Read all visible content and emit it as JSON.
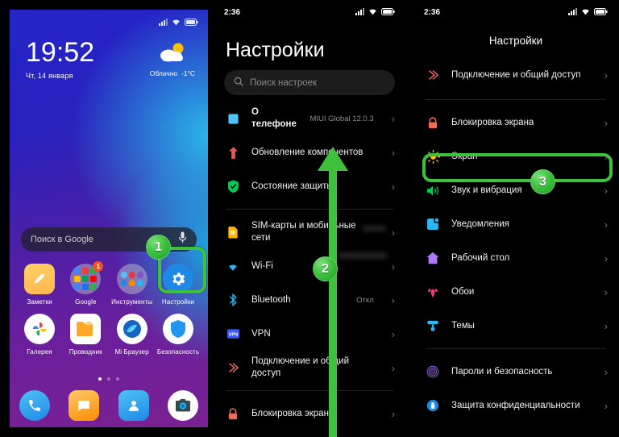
{
  "home": {
    "status_bar": {
      "icons": [
        "signal-icon",
        "wifi-icon",
        "battery-icon"
      ]
    },
    "clock": {
      "time": "19:52",
      "date": "Чт, 14 января"
    },
    "weather": {
      "condition": "Облачно",
      "temperature": "-1°C",
      "icon": "partly-cloudy-icon"
    },
    "search": {
      "placeholder": "Поиск в Google",
      "mic_icon": "microphone-icon",
      "search_icon": "google-search-icon"
    },
    "apps_row1": [
      {
        "label": "Заметки",
        "icon": "notes-icon",
        "badge": ""
      },
      {
        "label": "Google",
        "icon": "google-folder-icon",
        "badge": "1"
      },
      {
        "label": "Инструменты",
        "icon": "tools-folder-icon",
        "badge": ""
      },
      {
        "label": "Настройки",
        "icon": "settings-gear-icon",
        "badge": ""
      }
    ],
    "apps_row2": [
      {
        "label": "Галерея",
        "icon": "gallery-icon",
        "badge": ""
      },
      {
        "label": "Проводник",
        "icon": "file-manager-icon",
        "badge": ""
      },
      {
        "label": "Mi Браузер",
        "icon": "mi-browser-icon",
        "badge": ""
      },
      {
        "label": "Безопасность",
        "icon": "security-shield-icon",
        "badge": ""
      }
    ],
    "page_dots": {
      "count": 3,
      "active": 0
    },
    "dock": [
      {
        "label": "",
        "icon": "phone-icon"
      },
      {
        "label": "",
        "icon": "messages-icon"
      },
      {
        "label": "",
        "icon": "contacts-icon"
      },
      {
        "label": "",
        "icon": "camera-icon"
      }
    ]
  },
  "settings_main": {
    "status_bar": {
      "time": "2:36",
      "icons": [
        "signal-icon",
        "wifi-icon",
        "battery-icon"
      ]
    },
    "title": "Настройки",
    "search": {
      "placeholder": "Поиск настроек",
      "icon": "search-icon"
    },
    "rows": [
      {
        "label": "О телефоне",
        "value": "MIUI Global 12.0.3",
        "icon": "phone-info-icon"
      },
      {
        "label": "Обновление компонентов",
        "value": "",
        "icon": "update-arrow-icon"
      },
      {
        "label": "Состояние защиты",
        "value": "",
        "icon": "shield-check-icon"
      },
      {
        "label": "SIM-карты и мобильные сети",
        "value": "",
        "icon": "sim-card-icon"
      },
      {
        "label": "Wi-Fi",
        "value": "",
        "icon": "wifi-icon"
      },
      {
        "label": "Bluetooth",
        "value": "Откл",
        "icon": "bluetooth-icon"
      },
      {
        "label": "VPN",
        "value": "",
        "icon": "vpn-icon"
      },
      {
        "label": "Подключение и общий доступ",
        "value": "",
        "icon": "sharing-icon"
      },
      {
        "label": "Блокировка экрана",
        "value": "",
        "icon": "lock-icon"
      }
    ]
  },
  "settings_scrolled": {
    "status_bar": {
      "time": "2:36",
      "icons": [
        "signal-icon",
        "wifi-icon",
        "battery-icon"
      ]
    },
    "title": "Настройки",
    "rows": [
      {
        "label": "Подключение и общий доступ",
        "value": "",
        "icon": "sharing-icon"
      },
      {
        "label": "Блокировка экрана",
        "value": "",
        "icon": "lock-icon"
      },
      {
        "label": "Экран",
        "value": "",
        "icon": "brightness-icon"
      },
      {
        "label": "Звук и вибрация",
        "value": "",
        "icon": "speaker-icon"
      },
      {
        "label": "Уведомления",
        "value": "",
        "icon": "notifications-icon"
      },
      {
        "label": "Рабочий стол",
        "value": "",
        "icon": "home-screen-icon"
      },
      {
        "label": "Обои",
        "value": "",
        "icon": "wallpaper-icon"
      },
      {
        "label": "Темы",
        "value": "",
        "icon": "themes-icon"
      },
      {
        "label": "Пароли и безопасность",
        "value": "",
        "icon": "fingerprint-icon"
      },
      {
        "label": "Защита конфиденциальности",
        "value": "",
        "icon": "privacy-icon"
      }
    ]
  },
  "annotations": {
    "step1": "1",
    "step2": "2",
    "step3": "3",
    "highlight_color": "#3EC23E",
    "arrow": "scroll-up-arrow"
  },
  "colors": {
    "accent_green": "#3EC23E",
    "settings_blue": "#1E88E5",
    "background_dark": "#000000",
    "panel_gradient_start": "#2424C8",
    "panel_gradient_end": "#7A2193"
  }
}
